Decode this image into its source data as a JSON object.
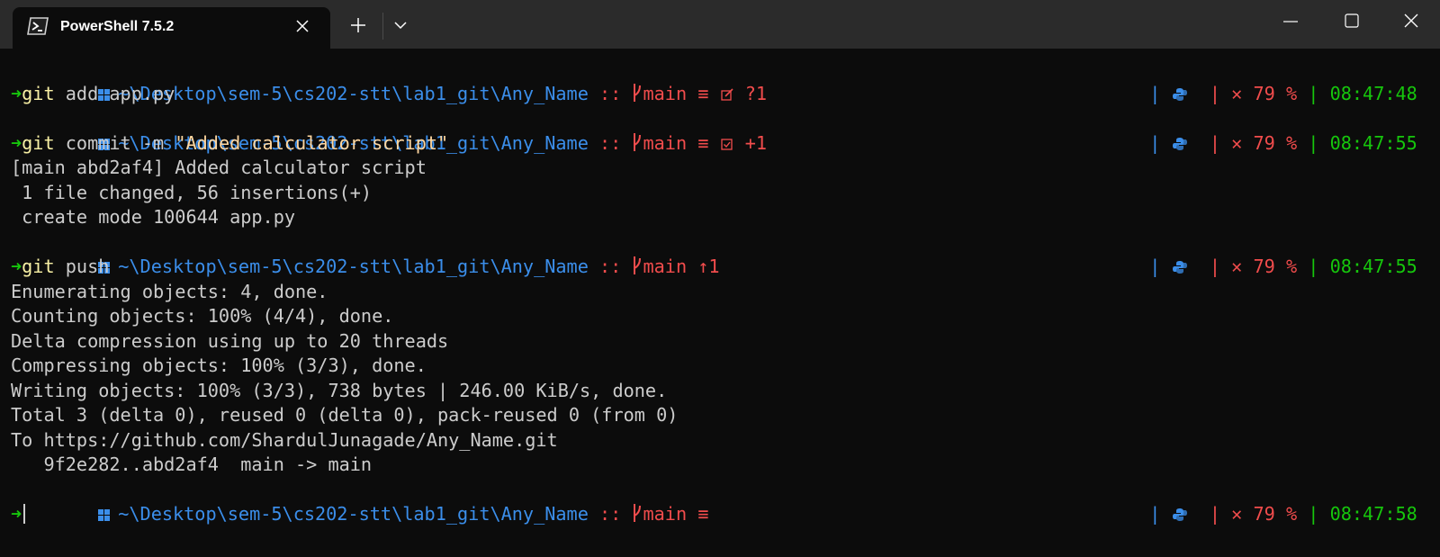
{
  "window": {
    "tab_title": "PowerShell 7.5.2",
    "tab_icon": "powershell-icon",
    "new_tab_icon": "plus-icon",
    "dropdown_icon": "chevron-down-icon",
    "controls": [
      "minimize-icon",
      "maximize-icon",
      "close-icon"
    ]
  },
  "colors": {
    "background": "#0c0c0c",
    "tabbar": "#2b2b2b",
    "path": "#3b8eea",
    "git": "#f14c4c",
    "success": "#16c60c",
    "time": "#16c60c"
  },
  "prompt_common": {
    "path": "~\\Desktop\\sem-5\\cs202-stt\\lab1_git\\Any_Name",
    "separator": "::",
    "branch": "main",
    "right_sep": "|",
    "error_mark": "✕",
    "battery": "79 %"
  },
  "prompts": [
    {
      "status": "≡",
      "extra": "?1",
      "status_icon": "edit-icon",
      "time": "08:47:48"
    },
    {
      "status": "≡",
      "extra": "+1",
      "status_icon": "checkbox-icon",
      "time": "08:47:55"
    },
    {
      "status": "↑1",
      "extra": "",
      "status_icon": "",
      "time": "08:47:55"
    },
    {
      "status": "≡",
      "extra": "",
      "status_icon": "",
      "time": "08:47:58"
    }
  ],
  "commands": [
    {
      "arrow": "➜",
      "git": "git",
      "args": " add app.py"
    },
    {
      "arrow": "➜",
      "git": "git",
      "args": " commit ",
      "flag": "-m",
      "string": " \"Added calculator script\""
    },
    {
      "arrow": "➜",
      "git": "git",
      "args": " push"
    },
    {
      "arrow": "➜"
    }
  ],
  "outputs": {
    "commit": [
      "[main abd2af4] Added calculator script",
      " 1 file changed, 56 insertions(+)",
      " create mode 100644 app.py"
    ],
    "push": [
      "Enumerating objects: 4, done.",
      "Counting objects: 100% (4/4), done.",
      "Delta compression using up to 20 threads",
      "Compressing objects: 100% (3/3), done.",
      "Writing objects: 100% (3/3), 738 bytes | 246.00 KiB/s, done.",
      "Total 3 (delta 0), reused 0 (delta 0), pack-reused 0 (from 0)",
      "To https://github.com/ShardulJunagade/Any_Name.git",
      "   9f2e282..abd2af4  main -> main"
    ]
  }
}
